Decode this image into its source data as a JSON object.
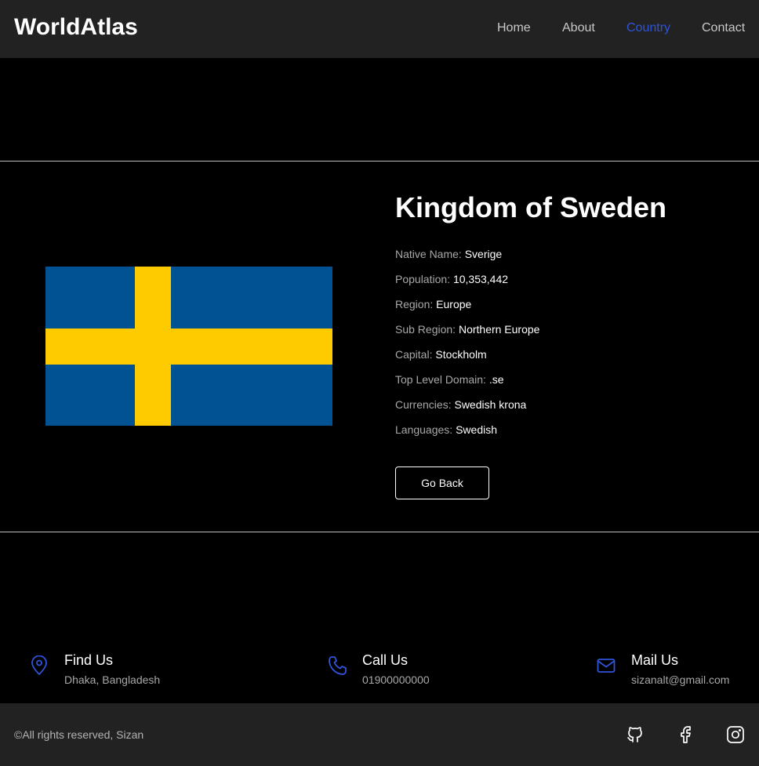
{
  "header": {
    "logo": "WorldAtlas",
    "nav": [
      {
        "label": "Home"
      },
      {
        "label": "About"
      },
      {
        "label": "Country"
      },
      {
        "label": "Contact"
      }
    ]
  },
  "country": {
    "title": "Kingdom of Sweden",
    "flag_colors": {
      "blue": "#005293",
      "yellow": "#FECB00"
    },
    "details": [
      {
        "label": "Native Name:",
        "value": "Sverige"
      },
      {
        "label": "Population:",
        "value": "10,353,442"
      },
      {
        "label": "Region:",
        "value": "Europe"
      },
      {
        "label": "Sub Region:",
        "value": "Northern Europe"
      },
      {
        "label": "Capital:",
        "value": "Stockholm"
      },
      {
        "label": "Top Level Domain:",
        "value": ".se"
      },
      {
        "label": "Currencies:",
        "value": "Swedish krona"
      },
      {
        "label": "Languages:",
        "value": "Swedish"
      }
    ],
    "go_back_label": "Go Back"
  },
  "contact": [
    {
      "icon": "map-pin-icon",
      "title": "Find Us",
      "sub": "Dhaka, Bangladesh"
    },
    {
      "icon": "phone-icon",
      "title": "Call Us",
      "sub": "01900000000"
    },
    {
      "icon": "mail-icon",
      "title": "Mail Us",
      "sub": "sizanalt@gmail.com"
    }
  ],
  "footer": {
    "copyright": "©All rights reserved, Sizan",
    "social": [
      "github-icon",
      "facebook-icon",
      "instagram-icon"
    ]
  },
  "colors": {
    "accent": "#2f54d9",
    "header_bg": "#222222",
    "page_bg": "#000000"
  }
}
